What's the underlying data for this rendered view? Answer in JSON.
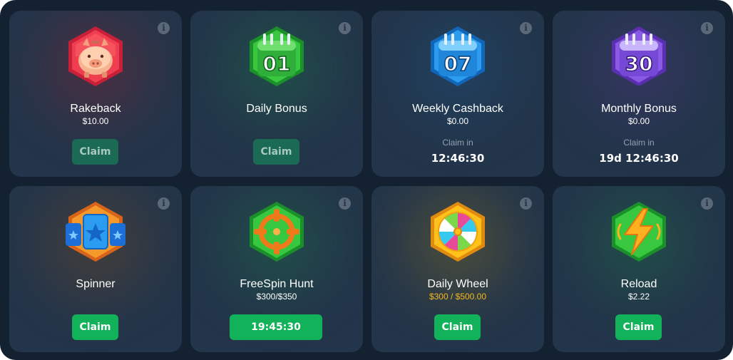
{
  "cards": [
    {
      "title": "Rakeback",
      "amount": "$10.00",
      "button": "Claim",
      "icon": "piggy-bank-icon"
    },
    {
      "title": "Daily Bonus",
      "button": "Claim",
      "icon": "calendar-icon",
      "badge_number": "01"
    },
    {
      "title": "Weekly Cashback",
      "amount": "$0.00",
      "claim_in_label": "Claim in",
      "timer": "12:46:30",
      "icon": "calendar-icon",
      "badge_number": "07"
    },
    {
      "title": "Monthly Bonus",
      "amount": "$0.00",
      "claim_in_label": "Claim in",
      "timer": "19d 12:46:30",
      "icon": "calendar-icon",
      "badge_number": "30"
    },
    {
      "title": "Spinner",
      "button": "Claim",
      "icon": "star-cards-icon"
    },
    {
      "title": "FreeSpin Hunt",
      "amount": "$300/$350",
      "button": "19:45:30",
      "icon": "crosshair-icon"
    },
    {
      "title": "Daily Wheel",
      "amount": "$300 / $500.00",
      "button": "Claim",
      "icon": "wheel-icon"
    },
    {
      "title": "Reload",
      "amount": "$2.22",
      "button": "Claim",
      "icon": "lightning-icon"
    }
  ],
  "info_icon": "i",
  "colors": {
    "background": "#132131",
    "card": "#23354a",
    "claim_active": "#11b25a",
    "claim_disabled": "#1a6a55",
    "gold_amount": "#f4b81e",
    "muted_text": "#94a1b0"
  }
}
